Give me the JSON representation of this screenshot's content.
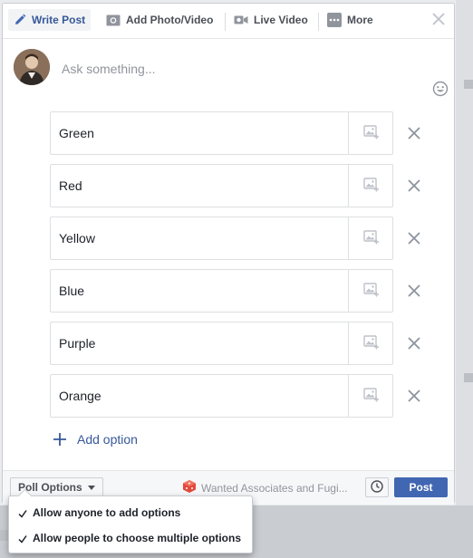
{
  "tabs": [
    {
      "label": "Write Post",
      "icon": "pencil-icon",
      "active": true
    },
    {
      "label": "Add Photo/Video",
      "icon": "camera-icon",
      "active": false
    },
    {
      "label": "Live Video",
      "icon": "video-camera-icon",
      "active": false
    },
    {
      "label": "More",
      "icon": "more-dots-icon",
      "active": false
    }
  ],
  "composer": {
    "placeholder": "Ask something..."
  },
  "poll": {
    "options": [
      "Green",
      "Red",
      "Yellow",
      "Blue",
      "Purple",
      "Orange"
    ],
    "add_option_label": "Add option"
  },
  "footer": {
    "poll_options_label": "Poll Options",
    "audience_label": "Wanted Associates and Fugi...",
    "post_label": "Post"
  },
  "dropdown": {
    "items": [
      {
        "label": "Allow anyone to add options",
        "checked": true
      },
      {
        "label": "Allow people to choose multiple options",
        "checked": true
      }
    ]
  },
  "colors": {
    "accent": "#4267b2",
    "link": "#365899",
    "muted": "#90949c"
  }
}
